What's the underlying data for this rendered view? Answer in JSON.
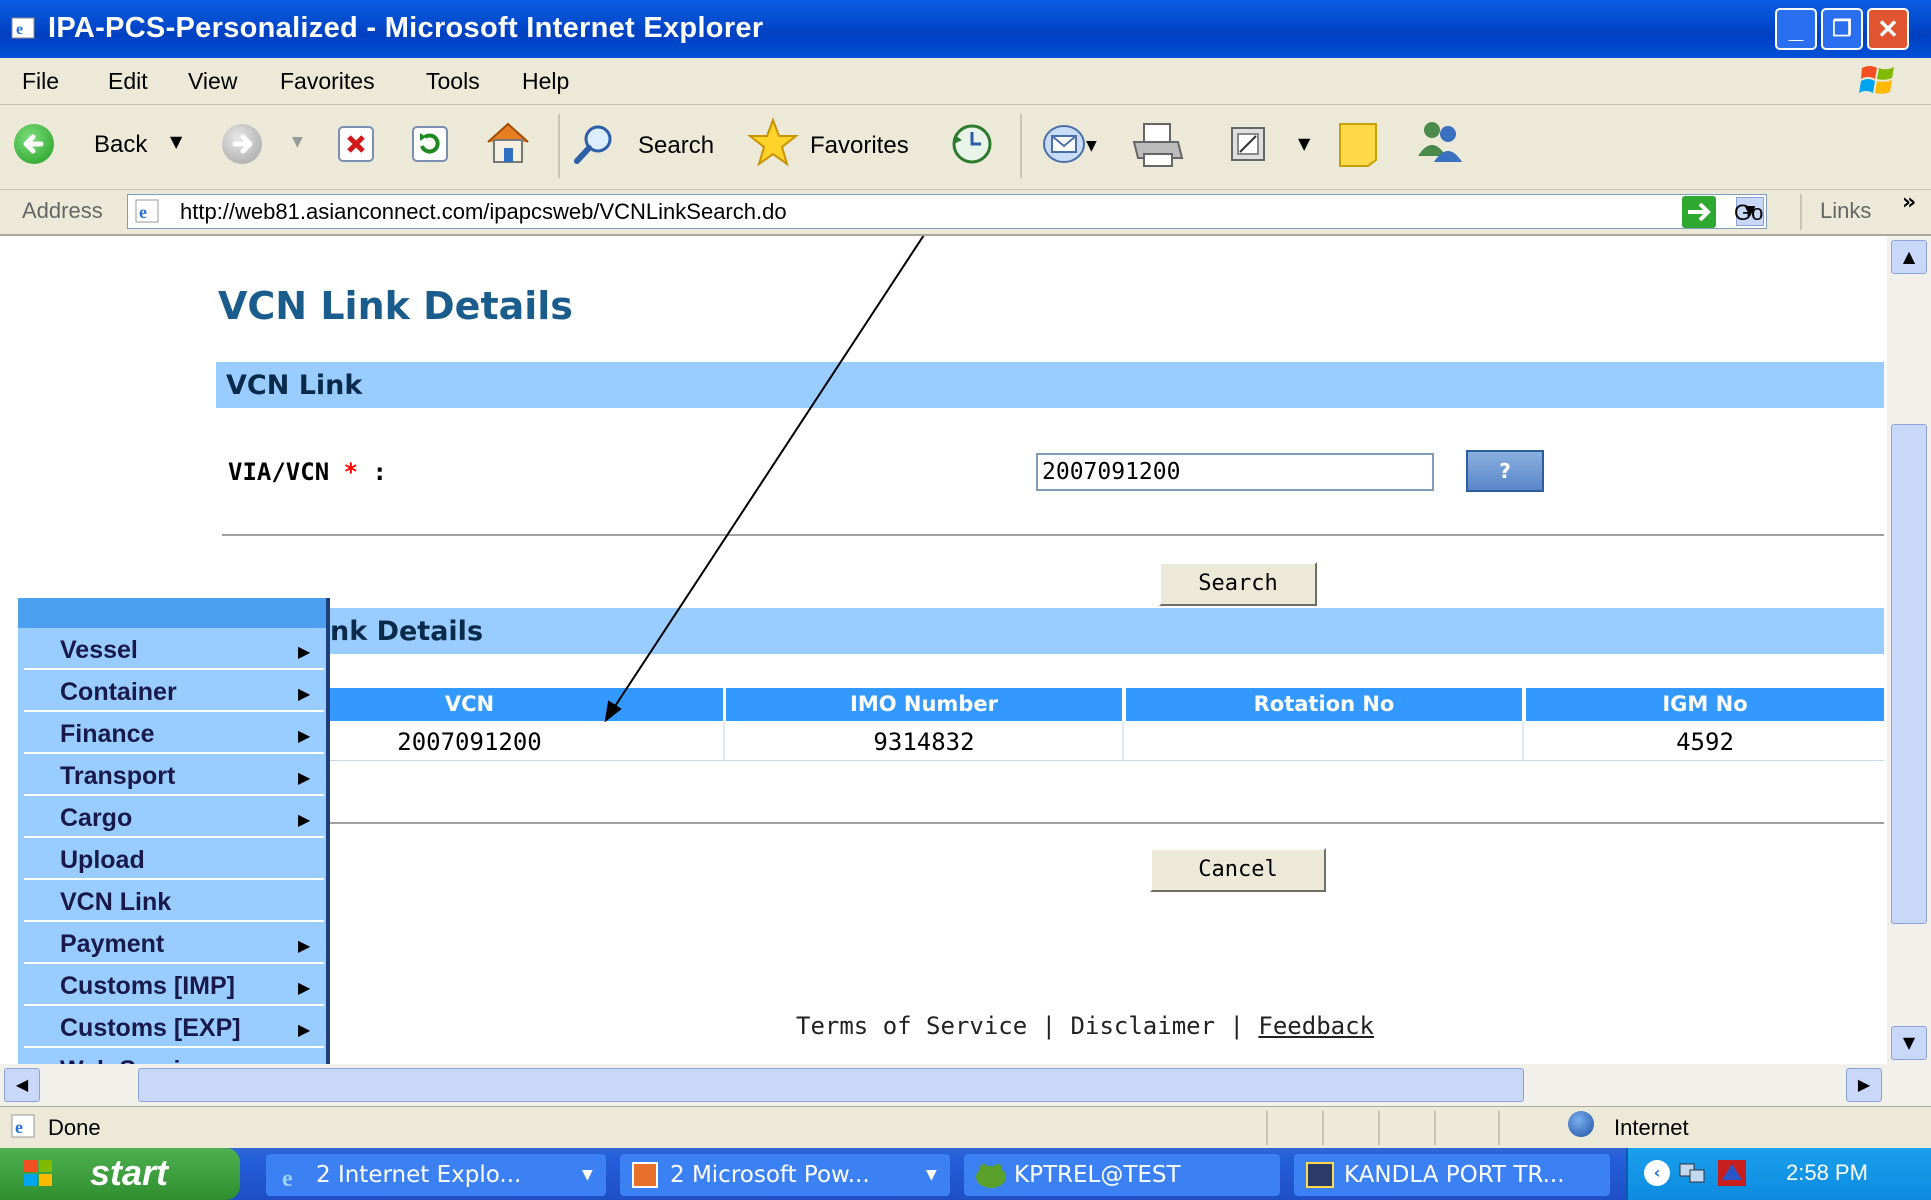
{
  "window": {
    "title": "IPA-PCS-Personalized - Microsoft Internet Explorer",
    "minimize": "_",
    "maximize": "❐",
    "close": "✕"
  },
  "menubar": {
    "items": [
      "File",
      "Edit",
      "View",
      "Favorites",
      "Tools",
      "Help"
    ]
  },
  "toolbar": {
    "back_label": "Back",
    "search_label": "Search",
    "favorites_label": "Favorites"
  },
  "addressbar": {
    "label": "Address",
    "url": "http://web81.asianconnect.com/ipapcsweb/VCNLinkSearch.do",
    "go_label": "Go",
    "links_label": "Links",
    "links_chevron": "»"
  },
  "page": {
    "title": "VCN Link Details",
    "section_vcn_link": "VCN Link",
    "via_label": "VIA/VCN",
    "required_mark": "*",
    "colon": ":",
    "via_value": "2007091200",
    "help_button": "?",
    "search_button": "Search",
    "section_details_partial": "nk Details",
    "table": {
      "headers": [
        "VCN",
        "IMO Number",
        "Rotation No",
        "IGM No"
      ],
      "rows": [
        [
          "2007091200",
          "9314832",
          "",
          "4592"
        ]
      ]
    },
    "cancel_button": "Cancel",
    "footer": {
      "terms": "Terms of Service",
      "sep1": "|",
      "disclaimer": "Disclaimer",
      "sep2": "|",
      "feedback": "Feedback"
    }
  },
  "left_menu": {
    "items": [
      {
        "label": "Vessel",
        "has_submenu": true
      },
      {
        "label": "Container",
        "has_submenu": true
      },
      {
        "label": "Finance",
        "has_submenu": true
      },
      {
        "label": "Transport",
        "has_submenu": true
      },
      {
        "label": "Cargo",
        "has_submenu": true
      },
      {
        "label": "Upload",
        "has_submenu": false
      },
      {
        "label": "VCN Link",
        "has_submenu": false
      },
      {
        "label": "Payment",
        "has_submenu": true
      },
      {
        "label": "Customs [IMP]",
        "has_submenu": true
      },
      {
        "label": "Customs [EXP]",
        "has_submenu": true
      },
      {
        "label": "Web Services",
        "has_submenu": true
      }
    ]
  },
  "statusbar": {
    "status": "Done",
    "zone": "Internet"
  },
  "taskbar": {
    "start": "start",
    "tasks": [
      "2 Internet Explo...",
      "2 Microsoft Pow...",
      "KPTREL@TEST",
      "KANDLA PORT TR..."
    ],
    "clock": "2:58 PM"
  },
  "colors": {
    "titlebar": "#0a5ee6",
    "section_bar": "#99ccff",
    "table_header": "#3399ff",
    "heading_text": "#1a5c8c",
    "required": "#ff0000",
    "taskbar": "#245edb",
    "start_button": "#3c9a3c"
  }
}
